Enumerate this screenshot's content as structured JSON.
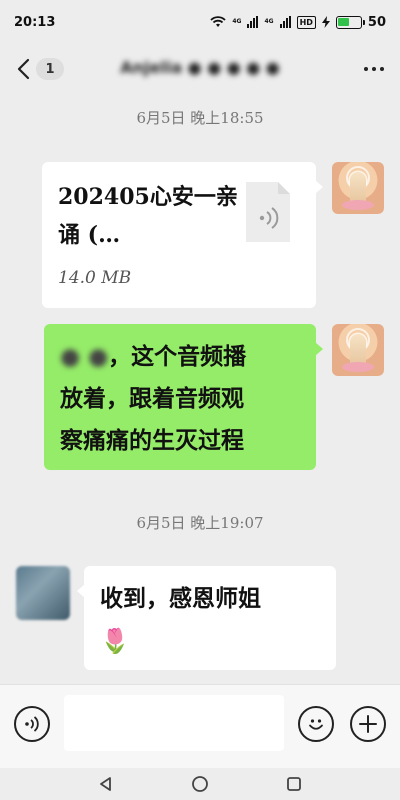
{
  "status_bar": {
    "time": "20:13",
    "net_4g_1": "4G",
    "net_4g_2": "4G",
    "hd_label": "HD",
    "battery": "50",
    "battery_level": 0.5,
    "battery_color": "#31c24c"
  },
  "header": {
    "unread_count": "1",
    "chat_title": "Anjelia ● ● ● ● ●"
  },
  "messages": [
    {
      "type": "timestamp",
      "text": "6月5日  晚上18:55"
    },
    {
      "type": "file",
      "file_name": "202405心安一亲诵  (…",
      "file_size": "14.0  MB"
    },
    {
      "type": "text",
      "blurred_prefix": "● ●",
      "text_line1": "，这个音频播",
      "text_line2": "放着，跟着音频观",
      "text_line3": "察痛痛的生灭过程"
    },
    {
      "type": "timestamp",
      "text": "6月5日  晚上19:07"
    },
    {
      "type": "text",
      "text_line1": "收到，感恩师姐",
      "emoji": "🌷"
    }
  ],
  "input": {
    "value": "",
    "placeholder": ""
  },
  "colors": {
    "chat_bg": "#ededed",
    "outgoing_bubble": "#95ec69",
    "incoming_bubble": "#ffffff",
    "emoji_red": "#e02b2b"
  },
  "icons": {
    "back": "chevron-left-icon",
    "more": "more-dots-icon",
    "voice": "voice-icon",
    "emoji": "emoji-icon",
    "plus": "plus-icon",
    "file": "audio-file-icon"
  }
}
